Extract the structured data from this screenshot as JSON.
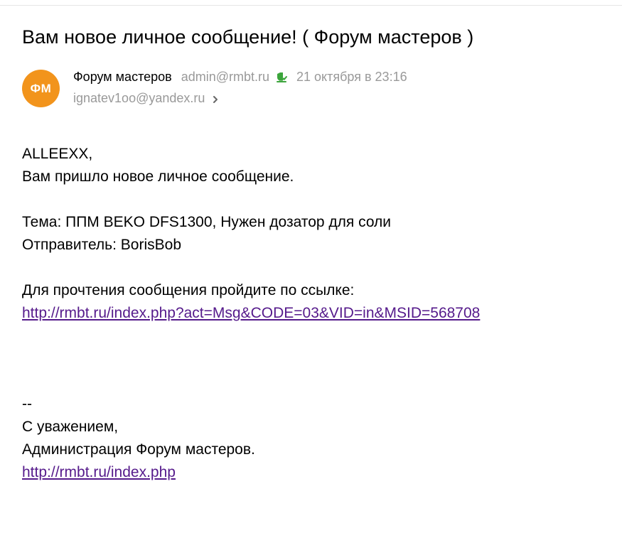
{
  "email": {
    "subject": "Вам новое личное сообщение! ( Форум мастеров )",
    "avatar_initials": "ФМ",
    "avatar_color": "#f2941c",
    "sender_name": "Форум мастеров",
    "sender_email": "admin@rmbt.ru",
    "verified_icon": "shield-check-icon",
    "date": "21 октября в 23:16",
    "recipient": "ignatev1oo@yandex.ru",
    "expand_icon": "chevron-right-icon"
  },
  "body": {
    "greeting": "ALLEEXX,",
    "intro": "Вам пришло новое личное сообщение.",
    "topic": "Тема: ППМ BEKO DFS1300, Нужен дозатор для соли",
    "sender": "Отправитель: BorisBob",
    "read_prompt": "Для прочтения сообщения пройдите по ссылке:",
    "message_link": "http://rmbt.ru/index.php?act=Msg&CODE=03&VID=in&MSID=568708",
    "signature_separator": "--",
    "regards": "С уважением,",
    "administration": "Администрация Форум мастеров.",
    "site_link": "http://rmbt.ru/index.php",
    "link_color": "#551a8b"
  }
}
